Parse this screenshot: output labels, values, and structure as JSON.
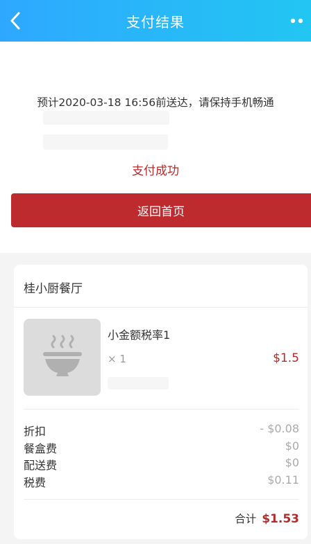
{
  "colors": {
    "nav_start": "#2ea8ff",
    "nav_end": "#22c6f2",
    "accent_red": "#b32b2b",
    "button_red": "#bd2b2f"
  },
  "nav": {
    "title": "支付结果",
    "back_icon": "chevron-left-icon",
    "more_icon": "more-dots-icon"
  },
  "result": {
    "eta_text": "预计2020-03-18 16:56前送达，请保持手机畅通",
    "status_text": "支付成功",
    "home_button_label": "返回首页"
  },
  "order": {
    "shop_name": "桂小厨餐厅",
    "item": {
      "name": "小金额税率1",
      "quantity": "× 1",
      "price": "$1.5",
      "image_icon": "bowl-icon"
    },
    "fees": [
      {
        "label": "折扣",
        "value": "- $0.08"
      },
      {
        "label": "餐盒费",
        "value": "$0"
      },
      {
        "label": "配送费",
        "value": "$0"
      },
      {
        "label": "税费",
        "value": "$0.11"
      }
    ],
    "total_label": "合计",
    "total_value": "$1.53"
  }
}
